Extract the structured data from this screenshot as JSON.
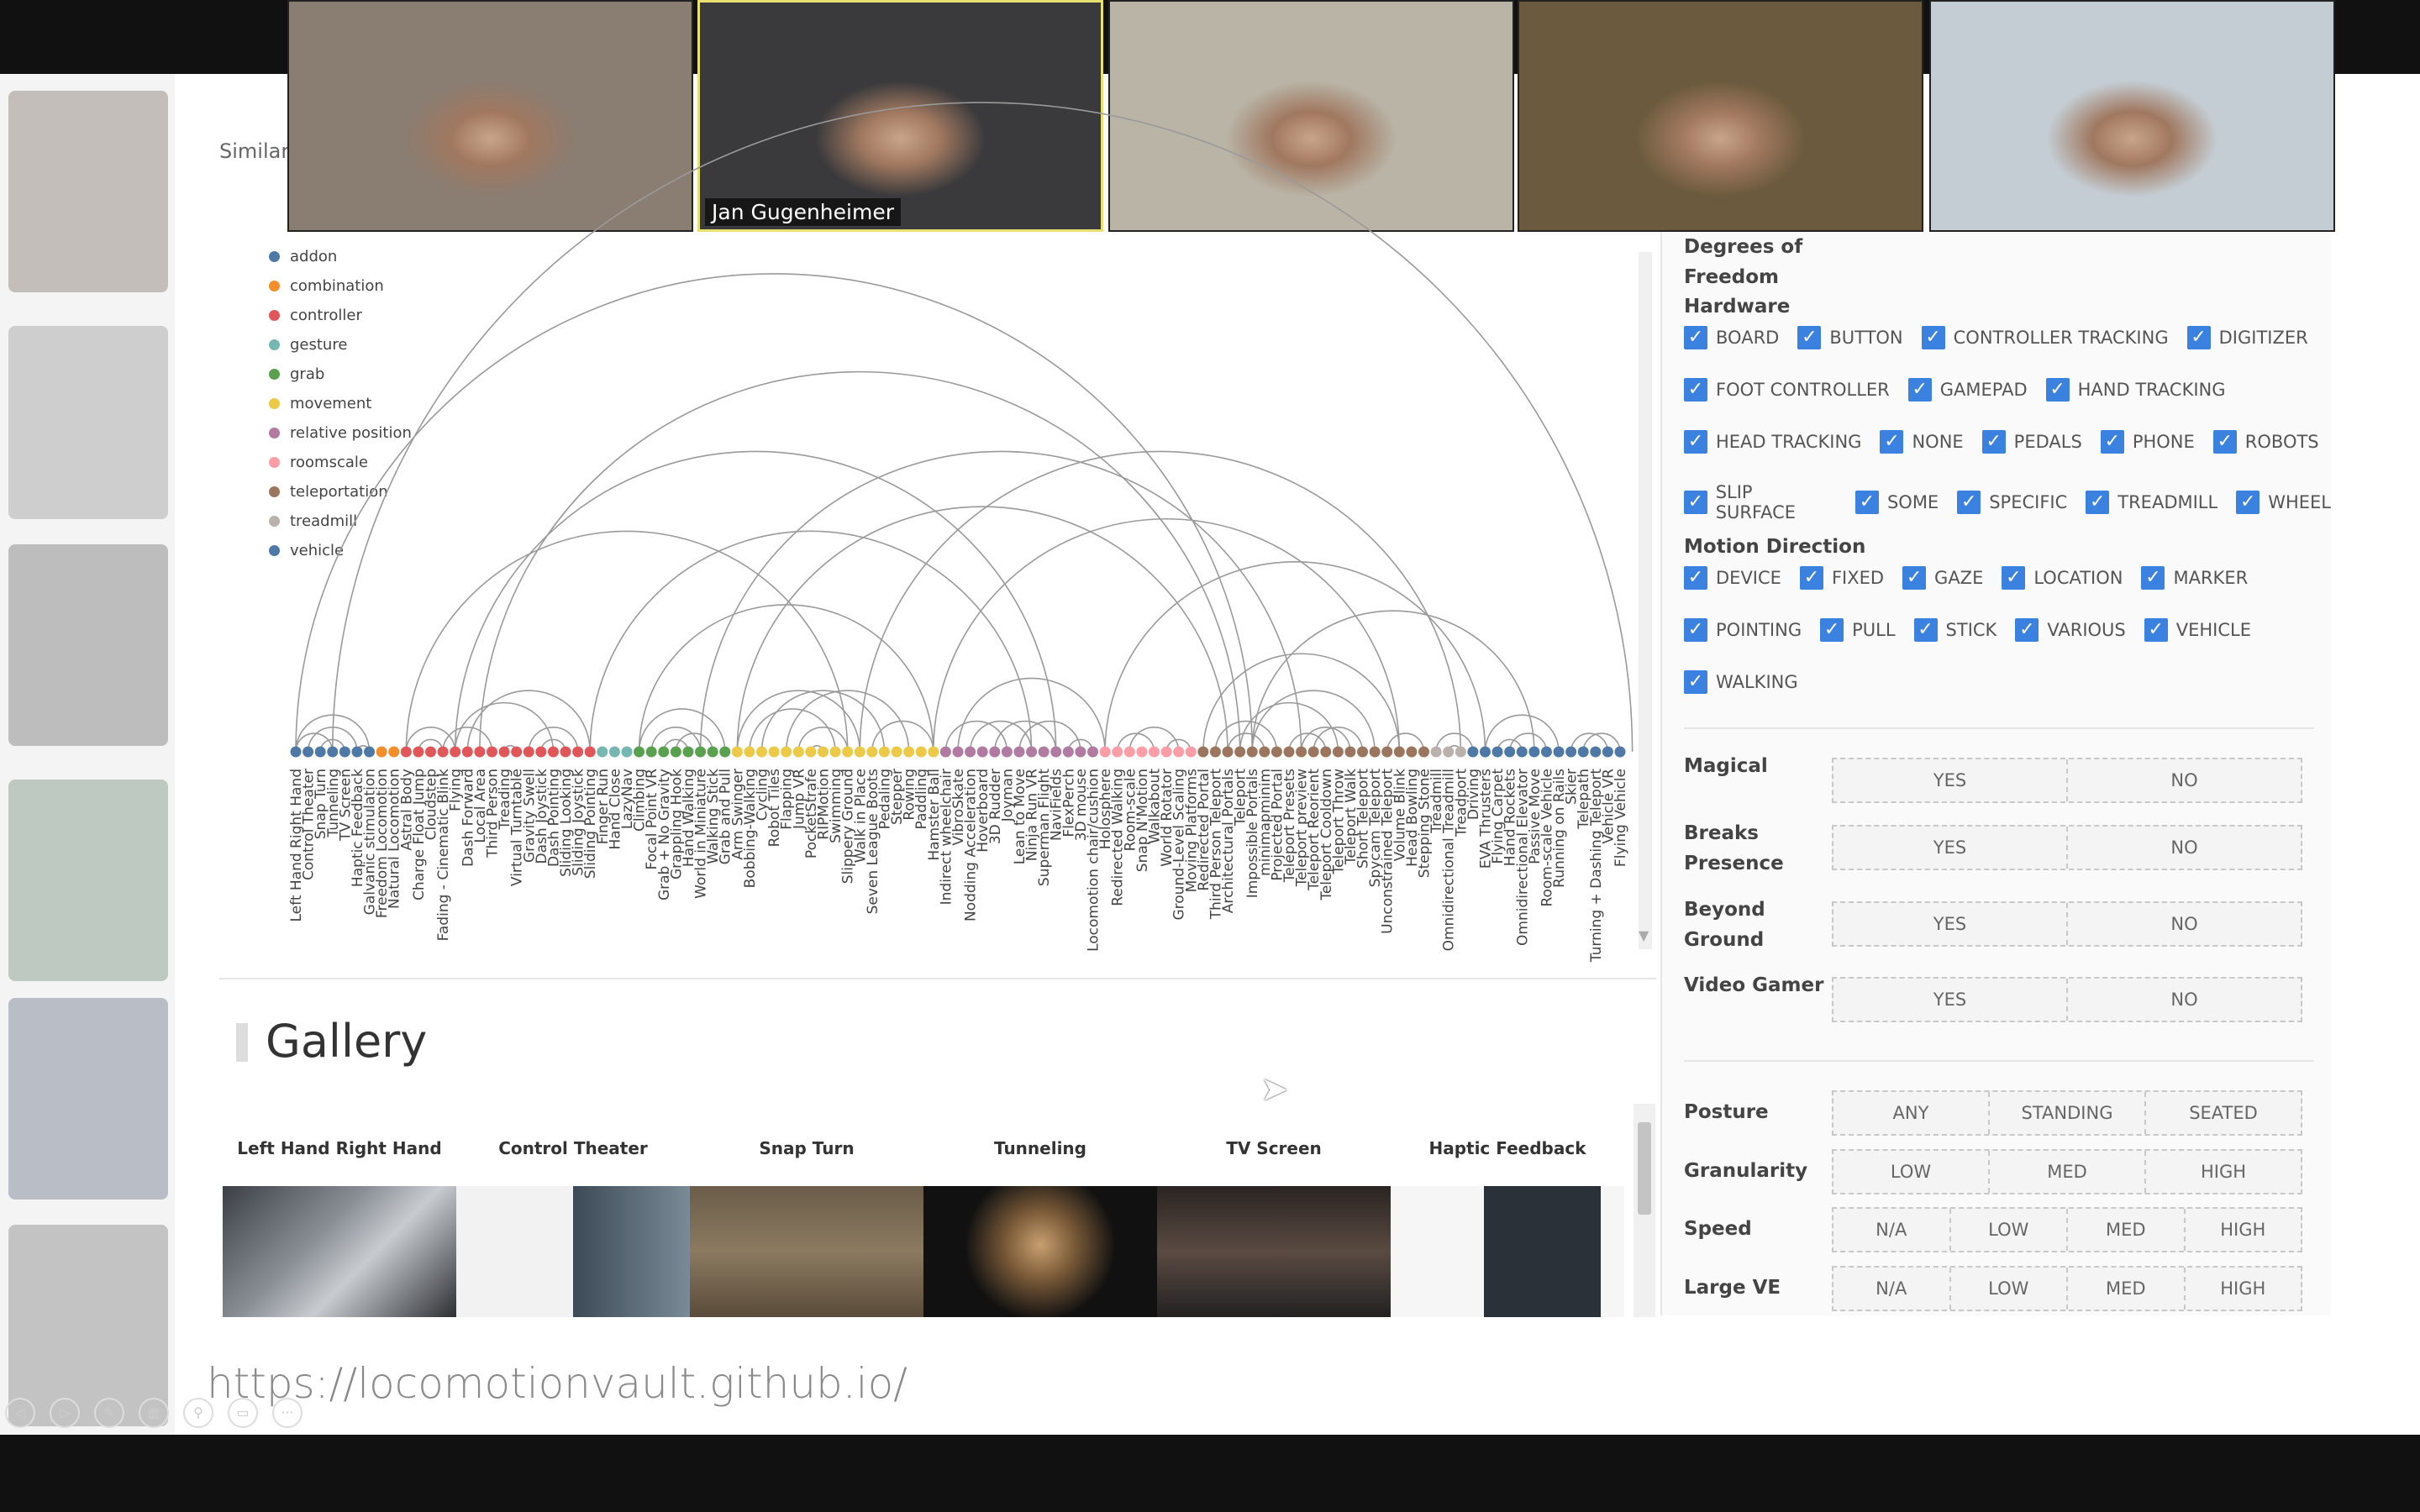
{
  "video_call": {
    "participants": [
      {
        "name": "",
        "bg": "#8a7d72"
      },
      {
        "name": "Jan Gugenheimer",
        "bg": "#3a3a3c",
        "active": true
      },
      {
        "name": "",
        "bg": "#b9b4a6"
      },
      {
        "name": "",
        "bg": "#6b5a3d"
      },
      {
        "name": "",
        "bg": "#c4cdd3"
      }
    ]
  },
  "header": {
    "similarity_label": "Similarit"
  },
  "chart_data": {
    "type": "network",
    "layout": "arc diagram",
    "legend_position": "top-left",
    "categories": [
      {
        "name": "addon",
        "color": "#4e79a7"
      },
      {
        "name": "combination",
        "color": "#f28e2b"
      },
      {
        "name": "controller",
        "color": "#e15759"
      },
      {
        "name": "gesture",
        "color": "#76b7b2"
      },
      {
        "name": "grab",
        "color": "#59a14f"
      },
      {
        "name": "movement",
        "color": "#edc948"
      },
      {
        "name": "relative position",
        "color": "#b07aa1"
      },
      {
        "name": "roomscale",
        "color": "#ff9da7"
      },
      {
        "name": "teleportation",
        "color": "#9c755f"
      },
      {
        "name": "treadmill",
        "color": "#bab0ac"
      },
      {
        "name": "vehicle",
        "color": "#4e79a7"
      }
    ],
    "nodes": [
      [
        "Left Hand Right Hand",
        0
      ],
      [
        "Control Theater",
        0
      ],
      [
        "Snap Turn",
        0
      ],
      [
        "Tunneling",
        0
      ],
      [
        "TV Screen",
        0
      ],
      [
        "Haptic Feedback",
        0
      ],
      [
        "Galvanic stimulation",
        0
      ],
      [
        "Freedom Locomotion",
        1
      ],
      [
        "Natural Locomotion",
        1
      ],
      [
        "Astral Body",
        2
      ],
      [
        "Charge Float Jump",
        2
      ],
      [
        "Cloudstep",
        2
      ],
      [
        "Fading - Cinematic Blink",
        2
      ],
      [
        "Flying",
        2
      ],
      [
        "Dash Forward",
        2
      ],
      [
        "Local Area",
        2
      ],
      [
        "Third Person",
        2
      ],
      [
        "Treading",
        2
      ],
      [
        "Virtual Turntable",
        2
      ],
      [
        "Gravity Swell",
        2
      ],
      [
        "Dash Joystick",
        2
      ],
      [
        "Dash Pointing",
        2
      ],
      [
        "Sliding Looking",
        2
      ],
      [
        "Sliding Joystick",
        2
      ],
      [
        "Sliding Pointing",
        2
      ],
      [
        "Finger Run",
        3
      ],
      [
        "Hand Close",
        3
      ],
      [
        "LazyNav",
        3
      ],
      [
        "Climbing",
        4
      ],
      [
        "Focal Point VR",
        4
      ],
      [
        "Grab + No Gravity",
        4
      ],
      [
        "Grappling Hook",
        4
      ],
      [
        "Hand Walking",
        4
      ],
      [
        "World in Miniature",
        4
      ],
      [
        "Walking Stick",
        4
      ],
      [
        "Grab and Pull",
        4
      ],
      [
        "Arm Swinger",
        5
      ],
      [
        "Bobbing-Walking",
        5
      ],
      [
        "Cycling",
        5
      ],
      [
        "Robot Tiles",
        5
      ],
      [
        "Flapping",
        5
      ],
      [
        "Jump VR",
        5
      ],
      [
        "PocketStrafe",
        5
      ],
      [
        "RIPMotion",
        5
      ],
      [
        "Swimming",
        5
      ],
      [
        "Slippery Ground",
        5
      ],
      [
        "Walk in Place",
        5
      ],
      [
        "Seven League Boots",
        5
      ],
      [
        "Pedaling",
        5
      ],
      [
        "Stepper",
        5
      ],
      [
        "Rowing",
        5
      ],
      [
        "Paddling",
        5
      ],
      [
        "Hamster Ball",
        5
      ],
      [
        "Indirect wheelchair",
        6
      ],
      [
        "VibroSkate",
        6
      ],
      [
        "Nodding Acceleration",
        6
      ],
      [
        "Hoverboard",
        6
      ],
      [
        "3D Rudder",
        6
      ],
      [
        "Joyman",
        6
      ],
      [
        "Lean to Move",
        6
      ],
      [
        "Ninja Run VR",
        6
      ],
      [
        "Superman Flight",
        6
      ],
      [
        "NaviFields",
        6
      ],
      [
        "FlexPerch",
        6
      ],
      [
        "3D mouse",
        6
      ],
      [
        "Locomotion chair/cushion",
        6
      ],
      [
        "Holosphere",
        7
      ],
      [
        "Redirected Walking",
        7
      ],
      [
        "Room-scale",
        7
      ],
      [
        "Snap N'Motion",
        7
      ],
      [
        "Walkabout",
        7
      ],
      [
        "World Rotator",
        7
      ],
      [
        "Ground-Level Scaling",
        7
      ],
      [
        "Moving Platforms",
        7
      ],
      [
        "Redirected Portal",
        8
      ],
      [
        "Third Person Teleport",
        8
      ],
      [
        "Architectural Portals",
        8
      ],
      [
        "Teleport",
        8
      ],
      [
        "Impossible Portals",
        8
      ],
      [
        "minimapminim",
        8
      ],
      [
        "Projected Portal",
        8
      ],
      [
        "Teleport Presets",
        8
      ],
      [
        "Teleport preview",
        8
      ],
      [
        "Teleport Reorient",
        8
      ],
      [
        "Teleport Cooldown",
        8
      ],
      [
        "Teleport Throw",
        8
      ],
      [
        "Teleport Walk",
        8
      ],
      [
        "Short Teleport",
        8
      ],
      [
        "Spycam Teleport",
        8
      ],
      [
        "Unconstrained Teleport",
        8
      ],
      [
        "Volume Blink",
        8
      ],
      [
        "Head Bowling",
        8
      ],
      [
        "Stepping Stone",
        8
      ],
      [
        "Treadmill",
        9
      ],
      [
        "Omnidirectional Treadmill",
        9
      ],
      [
        "Treadport",
        9
      ],
      [
        "Driving",
        10
      ],
      [
        "EVA Thrusters",
        10
      ],
      [
        "Flying Carpet",
        10
      ],
      [
        "Hand Rockets",
        10
      ],
      [
        "Omnidirectional Elevator",
        10
      ],
      [
        "Passive Move",
        10
      ],
      [
        "Room-scale Vehicle",
        10
      ],
      [
        "Running on Rails",
        10
      ],
      [
        "Skier",
        10
      ],
      [
        "Telepath",
        10
      ],
      [
        "Turning + Dashing Teleport",
        10
      ],
      [
        "Vehicle VR",
        10
      ],
      [
        "Flying Vehicle",
        10
      ]
    ],
    "links": [
      [
        0,
        3
      ],
      [
        0,
        6
      ],
      [
        2,
        4
      ],
      [
        1,
        5
      ],
      [
        5,
        6
      ],
      [
        9,
        13
      ],
      [
        10,
        12
      ],
      [
        12,
        16
      ],
      [
        13,
        21
      ],
      [
        14,
        24
      ],
      [
        17,
        18
      ],
      [
        19,
        23
      ],
      [
        20,
        22
      ],
      [
        0,
        78
      ],
      [
        3,
        109
      ],
      [
        9,
        45
      ],
      [
        13,
        62
      ],
      [
        28,
        35
      ],
      [
        29,
        33
      ],
      [
        30,
        32
      ],
      [
        31,
        34
      ],
      [
        28,
        52
      ],
      [
        36,
        46
      ],
      [
        37,
        44
      ],
      [
        38,
        48
      ],
      [
        40,
        50
      ],
      [
        41,
        45
      ],
      [
        42,
        43
      ],
      [
        47,
        52
      ],
      [
        36,
        76
      ],
      [
        46,
        95
      ],
      [
        53,
        58
      ],
      [
        55,
        60
      ],
      [
        57,
        62
      ],
      [
        59,
        64
      ],
      [
        63,
        65
      ],
      [
        54,
        66
      ],
      [
        67,
        70
      ],
      [
        68,
        72
      ],
      [
        71,
        73
      ],
      [
        74,
        90
      ],
      [
        75,
        80
      ],
      [
        76,
        79
      ],
      [
        77,
        85
      ],
      [
        78,
        88
      ],
      [
        81,
        84
      ],
      [
        82,
        86
      ],
      [
        83,
        87
      ],
      [
        89,
        92
      ],
      [
        78,
        101
      ],
      [
        93,
        96
      ],
      [
        94,
        95
      ],
      [
        97,
        103
      ],
      [
        98,
        100
      ],
      [
        99,
        102
      ],
      [
        104,
        107
      ],
      [
        105,
        108
      ],
      [
        66,
        97
      ],
      [
        24,
        60
      ],
      [
        15,
        77
      ],
      [
        52,
        90
      ],
      [
        33,
        82
      ]
    ]
  },
  "gallery": {
    "title": "Gallery",
    "cards": [
      {
        "title": "Left Hand Right Hand",
        "img": "linear-gradient(135deg,#3b3f45,#8a8f96 40%,#c8ccd0 60%,#2d2f33)"
      },
      {
        "title": "Control Theater",
        "img": "linear-gradient(90deg,#f2f2f2 0 50%,#3c4a57 50%,#7a8a96)"
      },
      {
        "title": "Snap Turn",
        "img": "linear-gradient(180deg,#6b5d4a,#8b7a60 50%,#5a4b3a)"
      },
      {
        "title": "Tunneling",
        "img": "radial-gradient(circle at 50% 45%,#c8a070 0,#7a5a38 25%,#111 55%)"
      },
      {
        "title": "TV Screen",
        "img": "linear-gradient(180deg,#2a2422,#5a4a42 50%,#222)"
      },
      {
        "title": "Haptic Feedback",
        "img": "linear-gradient(90deg,#f6f6f6 0 40%,#2b3138 40% 90%,#f6f6f6 90%)"
      }
    ]
  },
  "filters": {
    "dof_label": "Degrees of Freedom",
    "hardware": {
      "label": "Hardware",
      "rows": [
        [
          "BOARD",
          "BUTTON",
          "CONTROLLER TRACKING",
          "DIGITIZER"
        ],
        [
          "FOOT CONTROLLER",
          "GAMEPAD",
          "HAND TRACKING"
        ],
        [
          "HEAD TRACKING",
          "NONE",
          "PEDALS",
          "PHONE",
          "ROBOTS"
        ],
        [
          "SLIP SURFACE",
          "SOME",
          "SPECIFIC",
          "TREADMILL",
          "WHEEL"
        ]
      ]
    },
    "motion_direction": {
      "label": "Motion Direction",
      "rows": [
        [
          "DEVICE",
          "FIXED",
          "GAZE",
          "LOCATION",
          "MARKER"
        ],
        [
          "POINTING",
          "PULL",
          "STICK",
          "VARIOUS",
          "VEHICLE"
        ],
        [
          "WALKING"
        ]
      ]
    },
    "check_glyph": "✓",
    "toggles": [
      {
        "label": "Magical",
        "options": [
          "YES",
          "NO"
        ]
      },
      {
        "label": "Breaks Presence",
        "options": [
          "YES",
          "NO"
        ]
      },
      {
        "label": "Beyond Ground",
        "options": [
          "YES",
          "NO"
        ]
      },
      {
        "label": "Video Gamer",
        "options": [
          "YES",
          "NO"
        ]
      }
    ],
    "scales": [
      {
        "label": "Posture",
        "options": [
          "ANY",
          "STANDING",
          "SEATED"
        ]
      },
      {
        "label": "Granularity",
        "options": [
          "LOW",
          "MED",
          "HIGH"
        ]
      },
      {
        "label": "Speed",
        "options": [
          "N/A",
          "LOW",
          "MED",
          "HIGH"
        ]
      },
      {
        "label": "Large VE",
        "options": [
          "N/A",
          "LOW",
          "MED",
          "HIGH"
        ]
      }
    ]
  },
  "slide": {
    "url": "https://locomotionvault.github.io/"
  },
  "slideshow_controls": [
    "◁",
    "▷",
    "✎",
    "▦",
    "⚲",
    "▭",
    "···"
  ]
}
